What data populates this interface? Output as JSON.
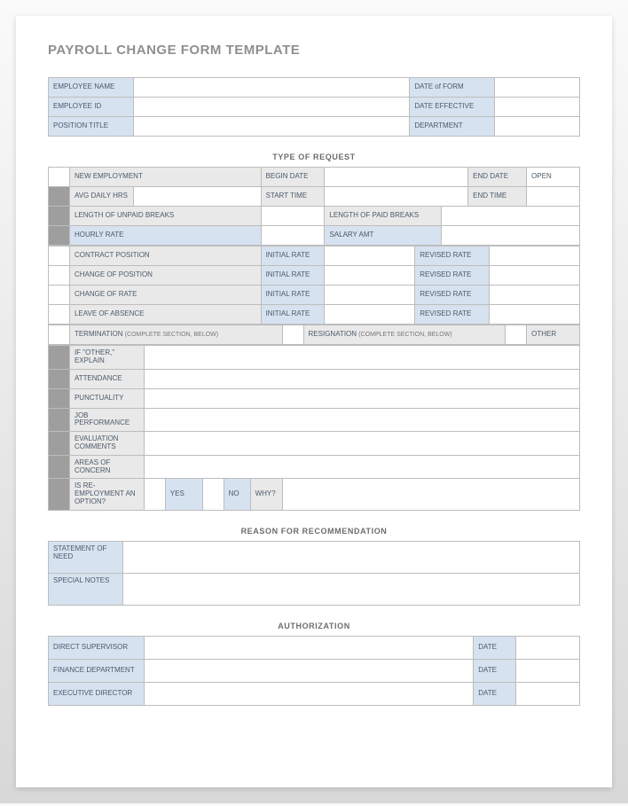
{
  "title": "PAYROLL CHANGE FORM TEMPLATE",
  "emp": {
    "name": "EMPLOYEE NAME",
    "id": "EMPLOYEE ID",
    "position": "POSITION TITLE",
    "dateForm": "DATE of FORM",
    "dateEff": "DATE EFFECTIVE",
    "dept": "DEPARTMENT"
  },
  "sections": {
    "request": "TYPE OF REQUEST",
    "reason": "REASON FOR RECOMMENDATION",
    "auth": "AUTHORIZATION"
  },
  "req": {
    "newEmp": "NEW EMPLOYMENT",
    "begin": "BEGIN DATE",
    "end": "END DATE",
    "open": "OPEN",
    "avg": "AVG DAILY HRS",
    "start": "START TIME",
    "endTime": "END TIME",
    "unpaid": "LENGTH OF UNPAID BREAKS",
    "paid": "LENGTH OF PAID BREAKS",
    "hourly": "HOURLY RATE",
    "salary": "SALARY AMT",
    "contract": "CONTRACT POSITION",
    "changePos": "CHANGE OF POSITION",
    "changeRate": "CHANGE OF RATE",
    "leave": "LEAVE OF ABSENCE",
    "initial": "INITIAL RATE",
    "revised": "REVISED RATE",
    "termination": "TERMINATION",
    "resignation": "RESIGNATION",
    "completeBelow": "(COMPLETE SECTION, BELOW)",
    "other": "OTHER"
  },
  "term": {
    "ifOther": "IF \"OTHER,\" EXPLAIN",
    "attendance": "ATTENDANCE",
    "punctuality": "PUNCTUALITY",
    "jobPerf": "JOB PERFORMANCE",
    "evalComments": "EVALUATION COMMENTS",
    "areas": "AREAS OF CONCERN",
    "reemp": "IS RE-EMPLOYMENT AN OPTION?",
    "yes": "YES",
    "no": "NO",
    "why": "WHY?"
  },
  "reason": {
    "statement": "STATEMENT OF NEED",
    "notes": "SPECIAL NOTES"
  },
  "auth": {
    "supervisor": "DIRECT SUPERVISOR",
    "finance": "FINANCE DEPARTMENT",
    "director": "EXECUTIVE DIRECTOR",
    "date": "DATE"
  }
}
